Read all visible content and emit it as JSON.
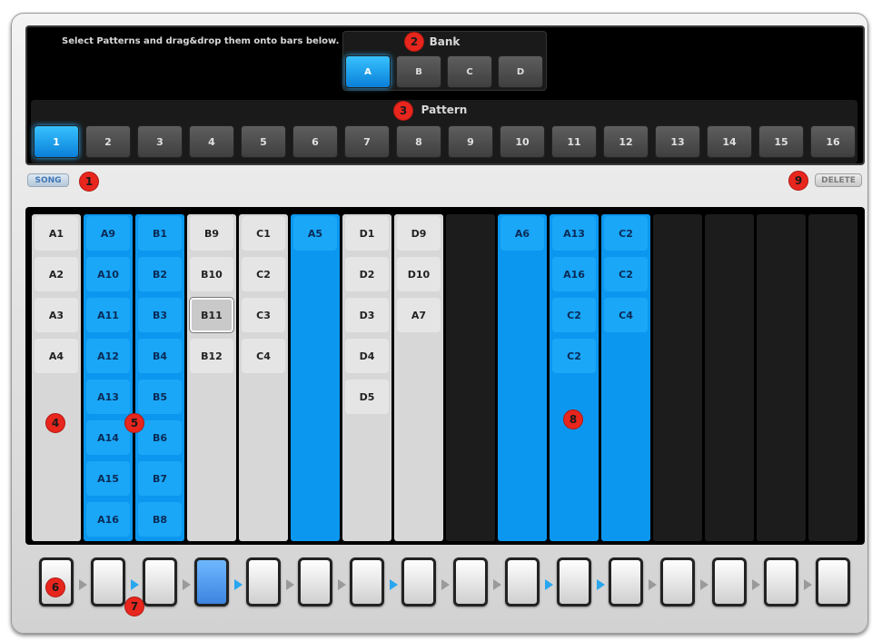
{
  "header": {
    "instruction": "Select Patterns and drag&drop them onto bars below.",
    "bank_title": "Bank",
    "pattern_title": "Pattern"
  },
  "bank": {
    "buttons": [
      "A",
      "B",
      "C",
      "D"
    ],
    "selected": "A"
  },
  "patterns": {
    "buttons": [
      "1",
      "2",
      "3",
      "4",
      "5",
      "6",
      "7",
      "8",
      "9",
      "10",
      "11",
      "12",
      "13",
      "14",
      "15",
      "16"
    ],
    "selected": "1"
  },
  "song_label": "SONG",
  "delete_label": "DELETE",
  "bars": [
    {
      "style": "light",
      "cells": [
        "A1",
        "A2",
        "A3",
        "A4"
      ]
    },
    {
      "style": "blue",
      "cells": [
        "A9",
        "A10",
        "A11",
        "A12",
        "A13",
        "A14",
        "A15",
        "A16"
      ]
    },
    {
      "style": "blue",
      "cells": [
        "B1",
        "B2",
        "B3",
        "B4",
        "B5",
        "B6",
        "B7",
        "B8"
      ]
    },
    {
      "style": "light",
      "cells": [
        "B9",
        "B10",
        "B11",
        "B12"
      ],
      "selected_cell": "B11"
    },
    {
      "style": "light",
      "cells": [
        "C1",
        "C2",
        "C3",
        "C4"
      ]
    },
    {
      "style": "blue",
      "cells": [
        "A5"
      ]
    },
    {
      "style": "light",
      "cells": [
        "D1",
        "D2",
        "D3",
        "D4",
        "D5"
      ]
    },
    {
      "style": "light",
      "cells": [
        "D9",
        "D10",
        "A7"
      ]
    },
    {
      "style": "empty",
      "cells": []
    },
    {
      "style": "blue",
      "cells": [
        "A6"
      ]
    },
    {
      "style": "blue",
      "cells": [
        "A13",
        "A16",
        "C2",
        "C2"
      ]
    },
    {
      "style": "blue",
      "cells": [
        "C2",
        "C2",
        "C4"
      ]
    },
    {
      "style": "empty",
      "cells": []
    },
    {
      "style": "empty",
      "cells": []
    },
    {
      "style": "empty",
      "cells": []
    },
    {
      "style": "empty",
      "cells": []
    }
  ],
  "steps": {
    "count": 16,
    "active_index": 3,
    "blue_arrows_after": [
      1,
      3,
      6,
      9,
      10
    ]
  },
  "markers": [
    "1",
    "2",
    "3",
    "4",
    "5",
    "6",
    "7",
    "8",
    "9"
  ],
  "colors": {
    "accent": "#0b97ef",
    "marker": "#e8261d"
  }
}
